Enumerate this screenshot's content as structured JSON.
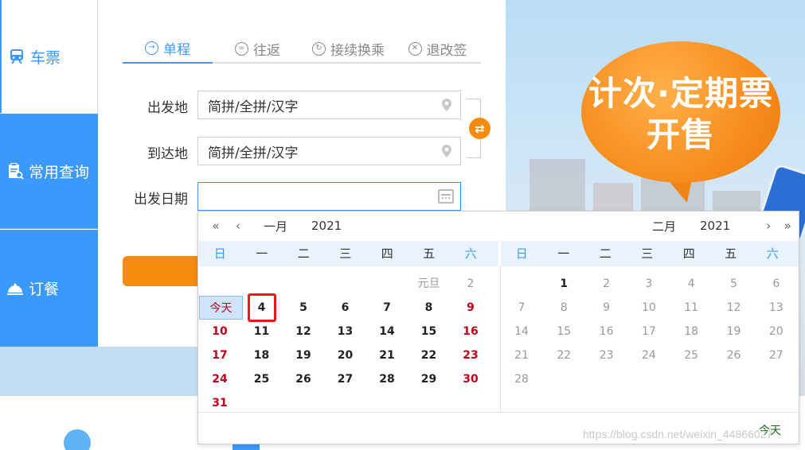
{
  "nav": {
    "ticket": "车票",
    "query": "常用查询",
    "meal": "订餐"
  },
  "tabs": [
    {
      "label": "单程",
      "icon": "→"
    },
    {
      "label": "往返",
      "icon": "="
    },
    {
      "label": "接续换乘",
      "icon": "↻"
    },
    {
      "label": "退改签",
      "icon": "✕"
    }
  ],
  "form": {
    "from_label": "出发地",
    "from_placeholder": "简拼/全拼/汉字",
    "to_label": "到达地",
    "to_placeholder": "简拼/全拼/汉字",
    "date_label": "出发日期",
    "swap_symbol": "⇄"
  },
  "promo": {
    "line1": "计次·定期票",
    "line2": "开售"
  },
  "datepicker": {
    "left_month": "一月",
    "left_year": "2021",
    "right_month": "二月",
    "right_year": "2021",
    "prev_year_symbol": "«",
    "prev_month_symbol": "‹",
    "next_month_symbol": "›",
    "next_year_symbol": "»",
    "weekdays": [
      "日",
      "一",
      "二",
      "三",
      "四",
      "五",
      "六"
    ],
    "today_label": "今天",
    "holiday_label": "元旦",
    "today_link": "今天",
    "selected_day": "4"
  },
  "watermark": "https://blog.csdn.net/weixin_44866027"
}
